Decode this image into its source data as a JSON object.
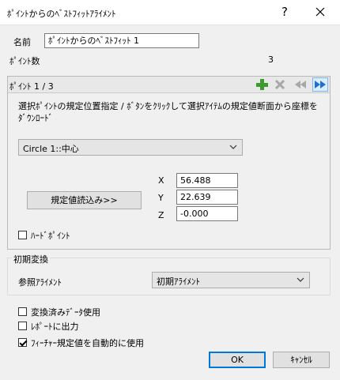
{
  "window": {
    "title": "ﾎﾟｲﾝﾄからのﾍﾞｽﾄﾌｨｯﾄｱﾗｲﾒﾝﾄ",
    "help_label": "?"
  },
  "name_field": {
    "label": "名前",
    "value": "ﾎﾟｲﾝﾄからのﾍﾞｽﾄﾌｨｯﾄ 1"
  },
  "point_count": {
    "label": "ﾎﾟｲﾝﾄ数",
    "value": "3"
  },
  "points": {
    "header": "ﾎﾟｲﾝﾄ 1 / 3",
    "instruction": "選択ﾎﾟｲﾝﾄの規定位置指定 / ﾎﾞﾀﾝをｸﾘｯｸして選択ｱｲﾃﾑの規定値断面から座標をﾀﾞｳﾝﾛｰﾄﾞ",
    "feature_select": "Circle 1::中心",
    "read_button": "規定値読込み>>",
    "x_label": "X",
    "x_value": "56.488",
    "y_label": "Y",
    "y_value": "22.639",
    "z_label": "Z",
    "z_value": "-0.000",
    "hard_point_label": "ﾊｰﾄﾞﾎﾟｲﾝﾄ"
  },
  "initial_transform": {
    "title": "初期変換",
    "ref_label": "参照ｱﾗｲﾒﾝﾄ",
    "ref_value": "初期ｱﾗｲﾒﾝﾄ"
  },
  "options": {
    "use_transformed": "変換済みﾃﾞｰﾀ使用",
    "report_output": "ﾚﾎﾟｰﾄに出力",
    "use_feature_nominal": "ﾌｨｰﾁｬｰ規定値を自動的に使用"
  },
  "buttons": {
    "ok": "OK",
    "cancel": "ｷｬﾝｾﾙ"
  },
  "colors": {
    "add_icon": "#3c9a2e",
    "nav_icon": "#1f6fd0",
    "default_border": "#0078d7"
  }
}
